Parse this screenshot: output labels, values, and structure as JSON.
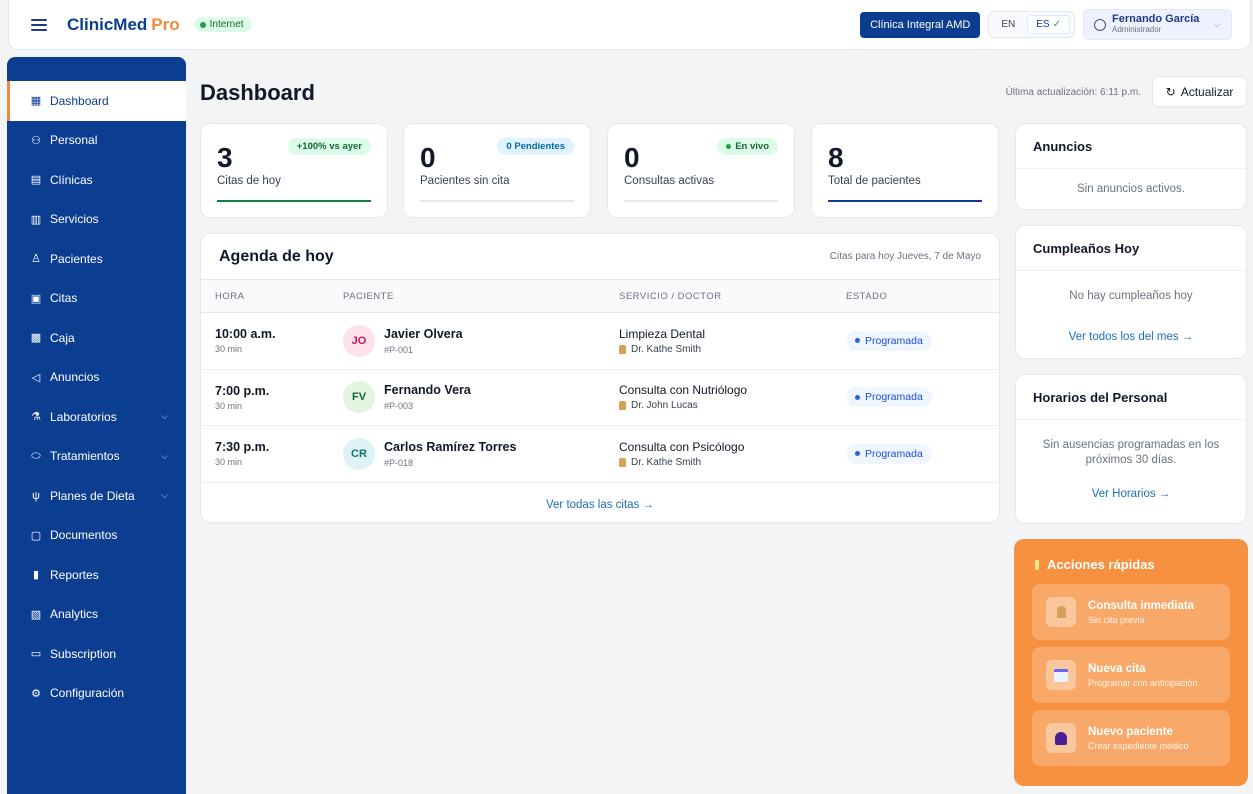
{
  "header": {
    "brand_main": "ClinicMed",
    "brand_accent": "Pro",
    "connection_status": "Internet",
    "clinic_button": "Clínica Integral AMD",
    "lang_en": "EN",
    "lang_es": "ES",
    "lang_check": "✓",
    "user_name": "Fernando García",
    "user_role": "Administrador"
  },
  "sidebar": {
    "items": [
      {
        "label": "Dashboard",
        "icon": "dashboard-icon"
      },
      {
        "label": "Personal",
        "icon": "users-icon"
      },
      {
        "label": "Clínicas",
        "icon": "building-icon"
      },
      {
        "label": "Servicios",
        "icon": "clipboard-icon"
      },
      {
        "label": "Pacientes",
        "icon": "user-icon"
      },
      {
        "label": "Citas",
        "icon": "calendar-icon"
      },
      {
        "label": "Caja",
        "icon": "cash-icon"
      },
      {
        "label": "Anuncios",
        "icon": "megaphone-icon"
      },
      {
        "label": "Laboratorios",
        "icon": "flask-icon"
      },
      {
        "label": "Tratamientos",
        "icon": "pill-icon"
      },
      {
        "label": "Planes de Dieta",
        "icon": "cutlery-icon"
      },
      {
        "label": "Documentos",
        "icon": "folder-icon"
      },
      {
        "label": "Reportes",
        "icon": "bar-chart-icon"
      },
      {
        "label": "Analytics",
        "icon": "analytics-icon"
      },
      {
        "label": "Subscription",
        "icon": "credit-card-icon"
      },
      {
        "label": "Configuración",
        "icon": "gear-icon"
      }
    ]
  },
  "page": {
    "title": "Dashboard",
    "last_update": "Última actualización: 6:11 p.m.",
    "refresh_label": "Actualizar"
  },
  "stats": [
    {
      "value": "3",
      "label": "Citas de hoy",
      "pill": "+100% vs ayer",
      "bar_color": "#15803d",
      "fill": 1.0
    },
    {
      "value": "0",
      "label": "Pacientes sin cita",
      "pill": "0 Pendientes",
      "bar_color": "#e5e7eb",
      "fill": 0.0
    },
    {
      "value": "0",
      "label": "Consultas activas",
      "pill": "En vivo",
      "bar_color": "#e5e7eb",
      "fill": 0.0
    },
    {
      "value": "8",
      "label": "Total de pacientes",
      "pill": "",
      "bar_color": "#0b3d91",
      "fill": 1.0
    }
  ],
  "agenda": {
    "title": "Agenda de hoy",
    "subtitle": "Citas para hoy Jueves, 7 de Mayo",
    "columns": [
      "HORA",
      "PACIENTE",
      "SERVICIO / DOCTOR",
      "ESTADO"
    ],
    "rows": [
      {
        "time": "10:00 a.m.",
        "duration": "30 min",
        "initials": "JO",
        "name": "Javier Olvera",
        "id": "#P-001",
        "service": "Limpieza Dental",
        "doctor": "Dr. Kathe Smith",
        "status": "Programada"
      },
      {
        "time": "7:00 p.m.",
        "duration": "30 min",
        "initials": "FV",
        "name": "Fernando Vera",
        "id": "#P-003",
        "service": "Consulta con Nutriólogo",
        "doctor": "Dr. John Lucas",
        "status": "Programada"
      },
      {
        "time": "7:30 p.m.",
        "duration": "30 min",
        "initials": "CR",
        "name": "Carlos Ramírez Torres",
        "id": "#P-018",
        "service": "Consulta con Psicólogo",
        "doctor": "Dr. Kathe Smith",
        "status": "Programada"
      }
    ],
    "footer_link": "Ver todas las citas →"
  },
  "announcements": {
    "title": "Anuncios",
    "empty": "Sin anuncios activos."
  },
  "birthdays": {
    "title": "Cumpleaños Hoy",
    "empty": "No hay cumpleaños hoy",
    "link": "Ver todos los del mes →"
  },
  "staff_schedule": {
    "title": "Horarios del Personal",
    "empty": "Sin ausencias programadas en los próximos 30 días.",
    "link": "Ver Horarios →"
  },
  "quick_actions": {
    "title": "Acciones rápidas",
    "items": [
      {
        "title": "Consulta inmediata",
        "subtitle": "Sin cita previa",
        "icon": "doctor-icon"
      },
      {
        "title": "Nueva cita",
        "subtitle": "Programar con anticipación",
        "icon": "calendar-icon"
      },
      {
        "title": "Nuevo paciente",
        "subtitle": "Crear expediente médico",
        "icon": "patient-icon"
      }
    ]
  },
  "colors": {
    "primary": "#0b3d91",
    "accent": "#f08a3c",
    "quick_actions_bg": "#f7913f"
  }
}
